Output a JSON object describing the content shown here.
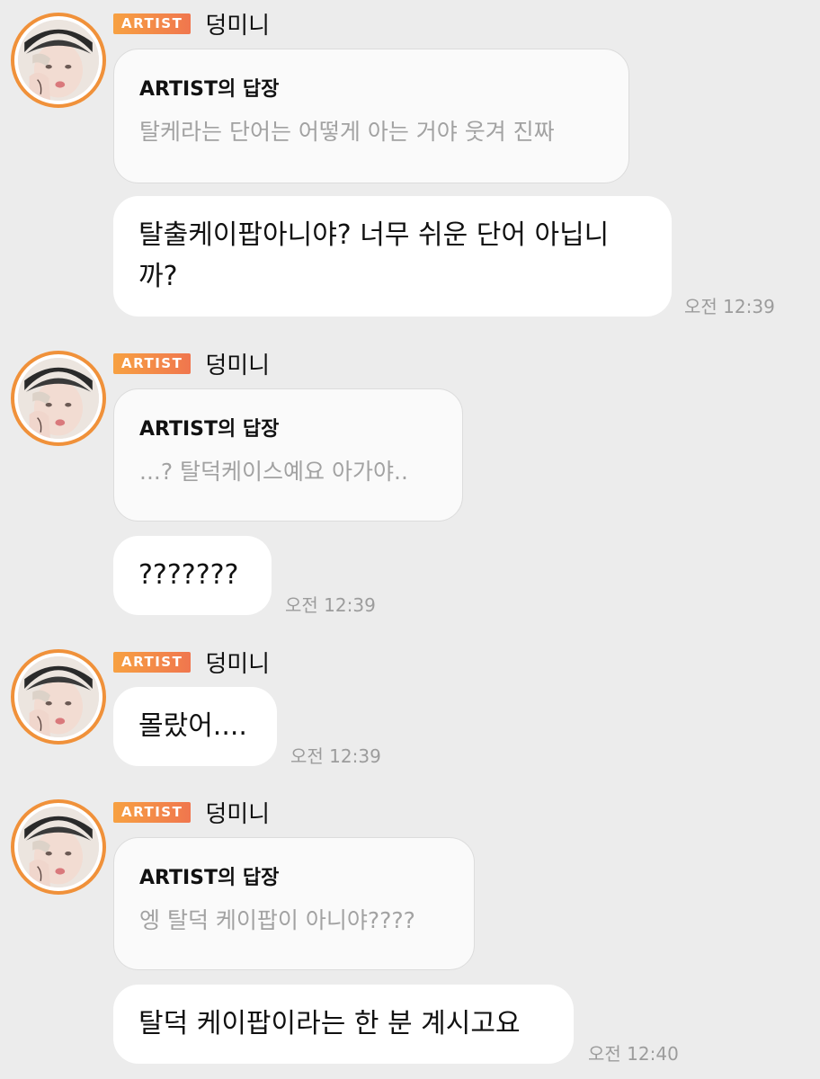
{
  "colors": {
    "background": "#ececec",
    "badge_gradient_start": "#f7a142",
    "badge_gradient_end": "#f0764e",
    "avatar_ring": "#f0913a",
    "reply_text": "#a2a2a2"
  },
  "messages": [
    {
      "badge": "ARTIST",
      "name": "덩미니",
      "reply_title": "ARTIST의 답장",
      "reply_text": "탈케라는 단어는 어떻게 아는 거야 웃겨 진짜",
      "text_line1": "탈출케이팝아니야? 너무 쉬운 단어 아닙니",
      "text_line2": "까?",
      "time": "오전 12:39"
    },
    {
      "badge": "ARTIST",
      "name": "덩미니",
      "reply_title": "ARTIST의 답장",
      "reply_text": "...? 탈덕케이스예요 아가야..",
      "text": "???????",
      "time": "오전 12:39"
    },
    {
      "badge": "ARTIST",
      "name": "덩미니",
      "text": "몰랐어....",
      "time": "오전 12:39"
    },
    {
      "badge": "ARTIST",
      "name": "덩미니",
      "reply_title": "ARTIST의 답장",
      "reply_text": "엥 탈덕 케이팝이 아니야????",
      "text": "탈덕 케이팝이라는 한 분 계시고요",
      "time": "오전 12:40"
    }
  ]
}
